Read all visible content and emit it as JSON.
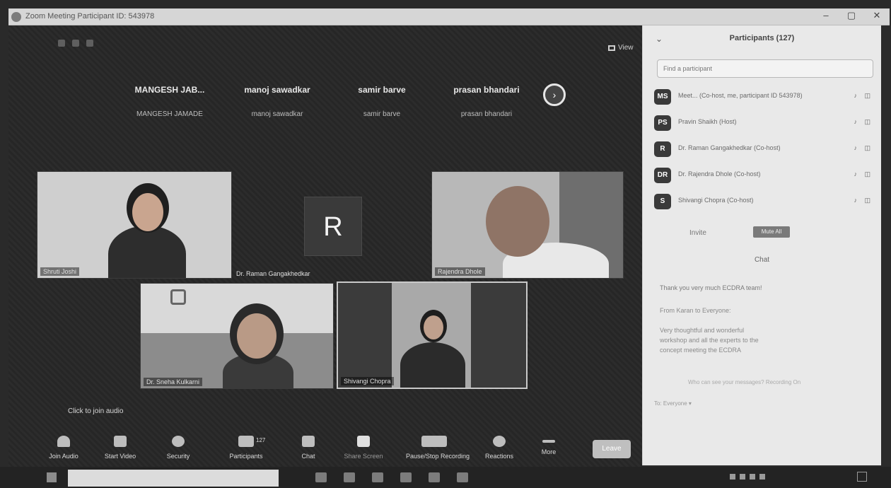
{
  "window": {
    "title": "Zoom Meeting Participant ID: 543978",
    "controls": [
      "–",
      "▢",
      "✕"
    ]
  },
  "toolbar_top": {
    "view_label": "View"
  },
  "name_strip": [
    {
      "big": "MANGESH JAB...",
      "small": "MANGESH JAMADE"
    },
    {
      "big": "manoj sawadkar",
      "small": "manoj sawadkar"
    },
    {
      "big": "samir barve",
      "small": "samir barve"
    },
    {
      "big": "prasan bhandari",
      "small": "prasan bhandari"
    }
  ],
  "next_page": "›",
  "video_tiles": [
    {
      "label": "Shruti Joshi"
    },
    {
      "label": "Dr. Raman Gangakhedkar"
    },
    {
      "label": "Rajendra Dhole"
    },
    {
      "label": "Dr. Sneha Kulkarni"
    },
    {
      "label": "Shivangi Chopra"
    }
  ],
  "avatar_tile": {
    "initial": "R"
  },
  "join_audio": "Click to join audio",
  "toolbar": [
    {
      "label": "Join Audio",
      "icon": "headphones-icon"
    },
    {
      "label": "Start Video",
      "icon": "video-icon"
    },
    {
      "label": "Security",
      "icon": "shield-icon"
    },
    {
      "label": "Participants",
      "icon": "participants-icon",
      "count": "127"
    },
    {
      "label": "Chat",
      "icon": "chat-icon"
    },
    {
      "label": "Share Screen",
      "icon": "share-icon"
    },
    {
      "label": "Pause/Stop Recording",
      "icon": "record-icon"
    },
    {
      "label": "Reactions",
      "icon": "reaction-icon"
    },
    {
      "label": "More",
      "icon": "more-icon"
    }
  ],
  "end_label": "Leave",
  "panel": {
    "title": "Participants (127)",
    "collapse": "⌄",
    "search_placeholder": "Find a participant",
    "participants": [
      {
        "initials": "MS",
        "name": "Meet... (Co-host, me, participant ID 543978)",
        "icons": "♪ ◫"
      },
      {
        "initials": "PS",
        "name": "Pravin Shaikh (Host)",
        "icons": "♪ ◫"
      },
      {
        "initials": "R",
        "name": "Dr. Raman Gangakhedkar (Co-host)",
        "icons": "♪ ◫"
      },
      {
        "initials": "DR",
        "name": "Dr. Rajendra Dhole (Co-host)",
        "icons": "♪ ◫"
      },
      {
        "initials": "S",
        "name": "Shivangi Chopra (Co-host)",
        "icons": "♪ ◫"
      }
    ],
    "invite": "Invite",
    "mute_all": "Mute All",
    "chat_title": "Chat",
    "chat_lines": [
      "Thank you very much ECDRA team!",
      "From Karan to Everyone:",
      "Very thoughtful and wonderful",
      "workshop and all the experts to the",
      "concept meeting the ECDRA"
    ],
    "chat_footer": "Who can see your messages? Recording On",
    "chat_to": "To: Everyone ▾"
  }
}
